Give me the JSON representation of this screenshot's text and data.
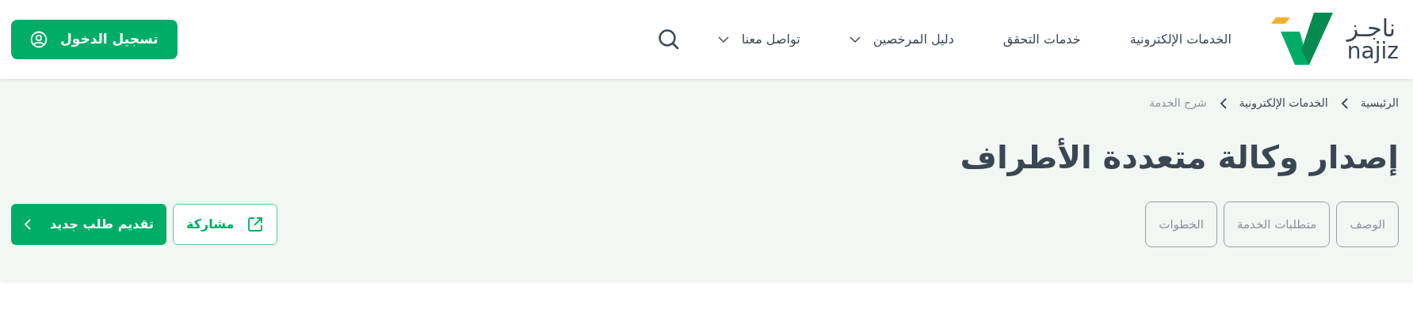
{
  "header": {
    "logo": {
      "arabic": "ناجـز",
      "latin": "najiz"
    },
    "nav": [
      {
        "label": "الخدمات الإلكترونية",
        "dropdown": false
      },
      {
        "label": "خدمات التحقق",
        "dropdown": false
      },
      {
        "label": "دليل المرخصين",
        "dropdown": true
      },
      {
        "label": "تواصل معنا",
        "dropdown": true
      }
    ],
    "login_button": "تسجيل الدخول"
  },
  "breadcrumb": [
    {
      "label": "الرئيسية",
      "current": false
    },
    {
      "label": "الخدمات الإلكترونية",
      "current": false
    },
    {
      "label": "شرح الخدمة",
      "current": true
    }
  ],
  "title": "إصدار وكالة متعددة الأطراف",
  "tabs": [
    {
      "label": "الوصف",
      "selected": false
    },
    {
      "label": "متطلبات الخدمة",
      "selected": false
    },
    {
      "label": "الخطوات",
      "selected": false
    }
  ],
  "actions": {
    "share": "مشاركة",
    "new_request": "تقديم طلب جديد"
  }
}
